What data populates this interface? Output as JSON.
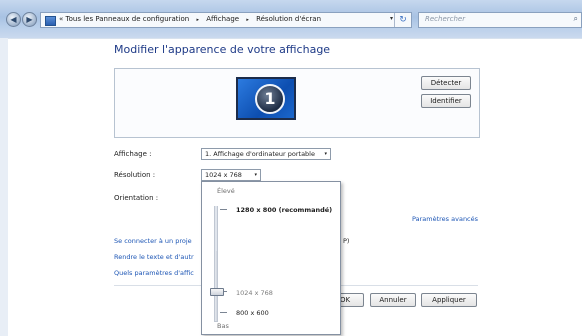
{
  "addressbar": {
    "chevron": "«",
    "crumbs": [
      "Tous les Panneaux de configuration",
      "Affichage",
      "Résolution d'écran"
    ],
    "separator": "▸",
    "dropdown": "▾",
    "refresh": "↻"
  },
  "search": {
    "placeholder": "Rechercher",
    "icon": "search-icon"
  },
  "page": {
    "heading": "Modifier l'apparence de votre affichage"
  },
  "preview": {
    "monitor_number": "1",
    "detect_label": "Détecter",
    "identify_label": "Identifier"
  },
  "settings": {
    "display_label": "Affichage :",
    "display_value": "1. Affichage d'ordinateur portable",
    "resolution_label": "Résolution :",
    "resolution_value": "1024 x 768",
    "orientation_label": "Orientation :",
    "caret": "▾"
  },
  "advanced_link": "Paramètres avancés",
  "links": {
    "connect_projector": "Se connecter à un proje",
    "connect_suffix": "P)",
    "text_size": "Rendre le texte et d'autr",
    "which_settings": "Quels paramètres d'affic"
  },
  "footer": {
    "ok_label": "OK",
    "cancel_label": "Annuler",
    "apply_label": "Appliquer"
  },
  "resolution_dropdown": {
    "high_label": "Élevé",
    "recommended": "1280 x 800 (recommandé)",
    "current": "1024 x 768",
    "lowest": "800 x 600",
    "low_label": "Bas",
    "slider_level": 0.25
  }
}
